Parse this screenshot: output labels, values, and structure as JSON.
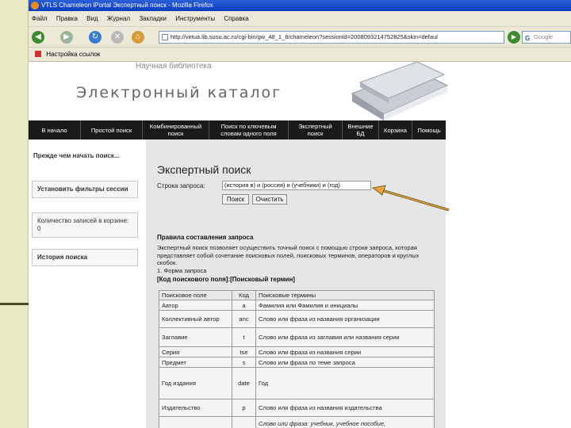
{
  "window": {
    "title": "VTLS Chameleon iPortal Экспертный поиск - Mozilla Firefox"
  },
  "menu": [
    "Файл",
    "Правка",
    "Вид",
    "Журнал",
    "Закладки",
    "Инструменты",
    "Справка"
  ],
  "nav": {
    "url": "http://virtua.lib.susu.ac.ru/cgi-bin/gw_48_1_8/chameleon?sessionid=2008093214752825&skin=defaul",
    "search_placeholder": "Google"
  },
  "bookmarks": {
    "item": "Настройка ссылок"
  },
  "page": {
    "lib_caption": "Научная библиотека",
    "catalog_title": "Электронный каталог",
    "topnav": [
      "В начало",
      "Простой поиск",
      "Комбинированный поиск",
      "Поиск по ключевым словам одного поля",
      "Экспертный поиск",
      "Внешние БД",
      "Корзина",
      "Помощь"
    ],
    "sidebar": {
      "intro": "Прежде чем начать поиск...",
      "filters": "Установить фильтры сессии",
      "basket": "Количество записей в корзине: 0",
      "history": "История поиска"
    },
    "main": {
      "title": "Экспертный поиск",
      "query_label": "Строка запроса:",
      "query_value": "(история в) и (россия) и (учебники) и (год)",
      "search_button": "Поиск",
      "clear_button": "Очистить",
      "rules_title": "Правила составления запроса",
      "rules_text": "Экспертный поиск позволяет осуществить точный поиск с помощью строки запроса, которая представляет собой сочетание поисковых полей, поисковых терминов, операторов и круглых скобок.",
      "form_item": "1. Форма запроса",
      "form_code": "[Код поискового поля]:[Поисковый термин]",
      "table": {
        "headers": [
          "Поисковое поле",
          "Код",
          "Поисковые термины"
        ],
        "rows": [
          [
            "Автор",
            "a",
            "Фамилия или Фамилия и инициалы"
          ],
          [
            "Коллективный автор",
            "anc",
            "Слово или фраза из названия организации"
          ],
          [
            "Заглавие",
            "t",
            "Слово или фраза из заглавия или названия серии"
          ],
          [
            "Серия",
            "tse",
            "Слово или фраза из названия серии"
          ],
          [
            "Предмет",
            "s",
            "Слово или фраза по теме запроса"
          ],
          [
            "Год издания",
            "date",
            "Год"
          ],
          [
            "Издательство",
            "p",
            "Слово или фраза из названия издательства"
          ],
          [
            "",
            "",
            "Слово или фраза: учебник, учебное пособие,"
          ]
        ]
      }
    }
  },
  "colors": {
    "titlebar": "#0b3cc0",
    "chrome": "#ece9d8",
    "topnav": "#1a1a1a",
    "arrow": "#e8a23a"
  }
}
